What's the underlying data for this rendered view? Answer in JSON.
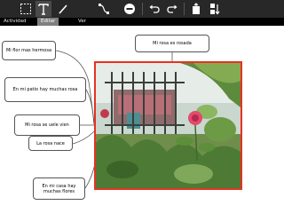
{
  "toolbar": {
    "icons": [
      "select-rectangle-icon",
      "text-icon",
      "pen-icon",
      "link-icon",
      "delete-icon",
      "undo-icon",
      "redo-icon",
      "import-image-icon",
      "sort-icon"
    ]
  },
  "tabs": [
    {
      "label": "Actividad"
    },
    {
      "label": "Editar"
    },
    {
      "label": "Ver"
    }
  ],
  "notes": {
    "top": "Mi rosa es rosada",
    "n1": "Mi  flor mas hermosa",
    "n2": "En mi patio hay muchas rosa",
    "n3": "Mi rosa se uele      vien",
    "n4": "La rosa nace",
    "n5": "En mi casa hay muchas flores"
  },
  "colors": {
    "toolbar_bg": "#282828",
    "active_tab_bg": "#808080",
    "selection_border": "#e53320"
  }
}
